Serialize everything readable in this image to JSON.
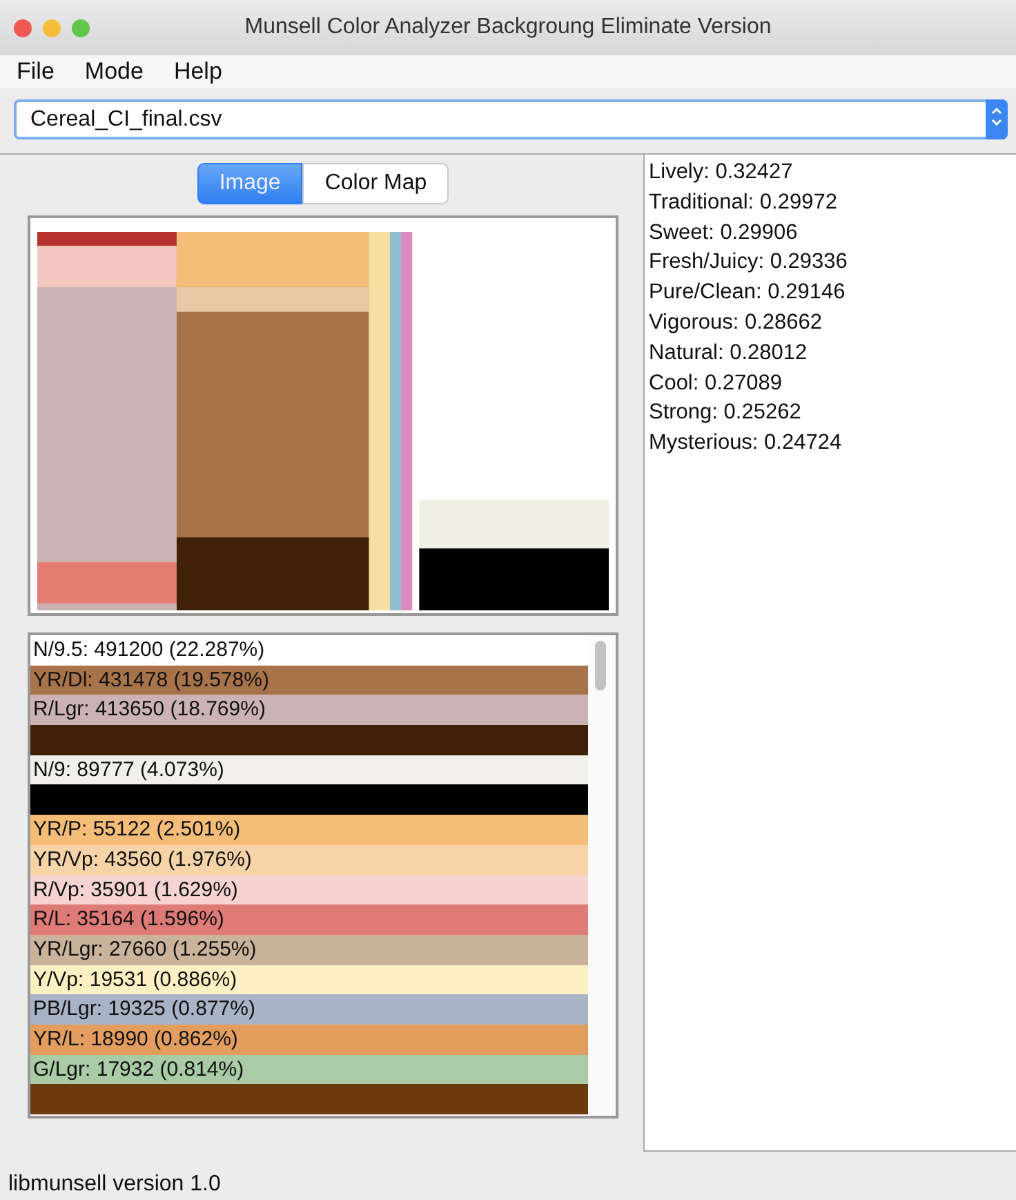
{
  "window": {
    "title": "Munsell Color Analyzer Backgroung Eliminate Version"
  },
  "menu": [
    "File",
    "Mode",
    "Help"
  ],
  "file_select": {
    "value": "Cereal_CI_final.csv"
  },
  "tabs": [
    {
      "label": "Image",
      "selected": true
    },
    {
      "label": "Color Map",
      "selected": false
    }
  ],
  "color_list": [
    {
      "text": "N/9.5: 491200 (22.287%)",
      "color": "#ffffff"
    },
    {
      "text": "YR/Dl: 431478 (19.578%)",
      "color": "#a8734a"
    },
    {
      "text": "R/Lgr: 413650 (18.769%)",
      "color": "#cbb3b3"
    },
    {
      "color": "#3f2208"
    },
    {
      "text": "N/9: 89777 (4.073%)",
      "color": "#f1f0ec"
    },
    {
      "color": "#000000"
    },
    {
      "text": "YR/P: 55122 (2.501%)",
      "color": "#f6bd78"
    },
    {
      "text": "YR/Vp: 43560 (1.976%)",
      "color": "#f7d4a8"
    },
    {
      "text": "R/Vp: 35901 (1.629%)",
      "color": "#f4d3d0"
    },
    {
      "text": "R/L: 35164 (1.596%)",
      "color": "#df7b76"
    },
    {
      "text": "YR/Lgr: 27660 (1.255%)",
      "color": "#c9b39a"
    },
    {
      "text": "Y/Vp: 19531 (0.886%)",
      "color": "#fdf0c3"
    },
    {
      "text": "PB/Lgr: 19325 (0.877%)",
      "color": "#a9b3c6"
    },
    {
      "text": "YR/L: 18990 (0.862%)",
      "color": "#e39e5f"
    },
    {
      "text": "G/Lgr: 17932 (0.814%)",
      "color": "#a9cba6"
    },
    {
      "color": "#6d3a10"
    }
  ],
  "scores": [
    "Lively: 0.32427",
    "Traditional: 0.29972",
    "Sweet: 0.29906",
    "Fresh/Juicy: 0.29336",
    "Pure/Clean: 0.29146",
    "Vigorous: 0.28662",
    "Natural: 0.28012",
    "Cool: 0.27089",
    "Strong: 0.25262",
    "Mysterious: 0.24724"
  ],
  "status_bar": "libmunsell version 1.0"
}
